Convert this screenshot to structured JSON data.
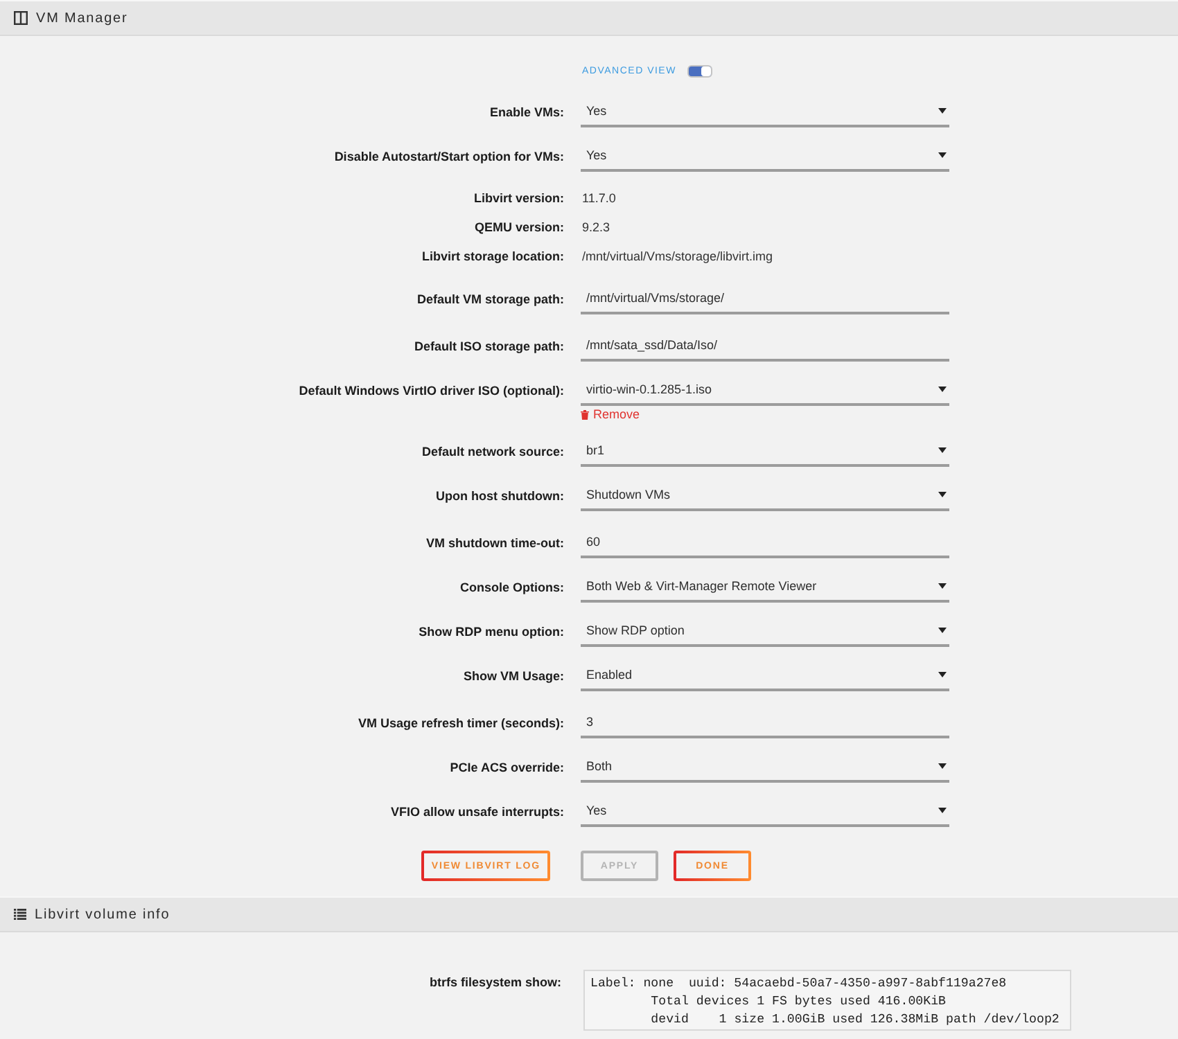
{
  "header": {
    "title": "VM Manager"
  },
  "advanced_view": {
    "label": "ADVANCED VIEW",
    "on": true
  },
  "settings": [
    {
      "kind": "select",
      "label": "Enable VMs:",
      "value": "Yes"
    },
    {
      "kind": "select",
      "label": "Disable Autostart/Start option for VMs:",
      "value": "Yes"
    },
    {
      "kind": "text",
      "label": "Libvirt version:",
      "value": "11.7.0"
    },
    {
      "kind": "text",
      "label": "QEMU version:",
      "value": "9.2.3"
    },
    {
      "kind": "text",
      "label": "Libvirt storage location:",
      "value": "/mnt/virtual/Vms/storage/libvirt.img"
    },
    {
      "kind": "input",
      "label": "Default VM storage path:",
      "value": "/mnt/virtual/Vms/storage/"
    },
    {
      "kind": "input",
      "label": "Default ISO storage path:",
      "value": "/mnt/sata_ssd/Data/Iso/"
    },
    {
      "kind": "select",
      "label": "Default Windows VirtIO driver ISO (optional):",
      "value": "virtio-win-0.1.285-1.iso",
      "action": "Remove"
    },
    {
      "kind": "select",
      "label": "Default network source:",
      "value": "br1"
    },
    {
      "kind": "select",
      "label": "Upon host shutdown:",
      "value": "Shutdown VMs"
    },
    {
      "kind": "input",
      "label": "VM shutdown time-out:",
      "value": "60"
    },
    {
      "kind": "select",
      "label": "Console Options:",
      "value": "Both Web & Virt-Manager Remote Viewer"
    },
    {
      "kind": "select",
      "label": "Show RDP menu option:",
      "value": "Show RDP option"
    },
    {
      "kind": "select",
      "label": "Show VM Usage:",
      "value": "Enabled"
    },
    {
      "kind": "input",
      "label": "VM Usage refresh timer (seconds):",
      "value": "3"
    },
    {
      "kind": "select",
      "label": "PCIe ACS override:",
      "value": "Both"
    },
    {
      "kind": "select",
      "label": "VFIO allow unsafe interrupts:",
      "value": "Yes"
    }
  ],
  "buttons": [
    {
      "label": "VIEW LIBVIRT LOG",
      "disabled": false
    },
    {
      "label": "APPLY",
      "disabled": true
    },
    {
      "label": "DONE",
      "disabled": false
    }
  ],
  "volume_header": {
    "title": "Libvirt volume info"
  },
  "volume_info": {
    "label": "btrfs filesystem show:",
    "output": "Label: none  uuid: 54acaebd-50a7-4350-a997-8abf119a27e8\n\tTotal devices 1 FS bytes used 416.00KiB\n\tdevid    1 size 1.00GiB used 126.38MiB path /dev/loop2"
  }
}
